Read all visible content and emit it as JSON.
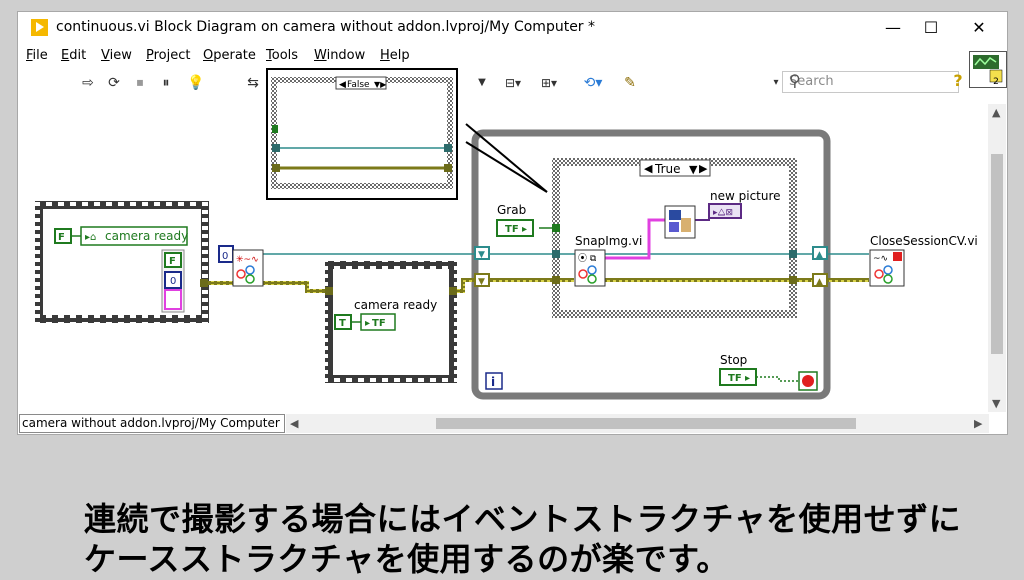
{
  "window": {
    "title": "continuous.vi Block Diagram on camera without addon.lvproj/My Computer *",
    "minimize": "—",
    "maximize": "☐",
    "close": "✕"
  },
  "menu": {
    "items": [
      {
        "label": "File",
        "key": "F"
      },
      {
        "label": "Edit",
        "key": "E"
      },
      {
        "label": "View",
        "key": "V"
      },
      {
        "label": "Project",
        "key": "P"
      },
      {
        "label": "Operate",
        "key": "O"
      },
      {
        "label": "Tools",
        "key": "T"
      },
      {
        "label": "Window",
        "key": "W"
      },
      {
        "label": "Help",
        "key": "H"
      }
    ]
  },
  "toolbar": {
    "run": "⇨",
    "run_continuous": "⟳",
    "abort": "⏹",
    "pause": "⏸",
    "highlight": "💡",
    "retain": "⇆",
    "search_placeholder": "Search",
    "help_glyph": "?"
  },
  "connector": {
    "label": "2"
  },
  "diagram": {
    "case_false_label": "False",
    "case_true_label": "True",
    "frame1_bool_label": "F",
    "frame1_camera_ready": "camera ready",
    "frame1_stack_f": "F",
    "frame1_numeric": "0",
    "init_numeric": "0",
    "frame2_camera_ready": "camera ready",
    "frame2_bool_label": "T",
    "frame2_tf": "TF",
    "grab_label": "Grab",
    "grab_tf": "TF",
    "grab_q": "?",
    "snap_label": "SnapImg.vi",
    "new_picture_label": "new picture",
    "close_label": "CloseSessionCV.vi",
    "stop_label": "Stop",
    "stop_tf": "TF",
    "loop_index": "i"
  },
  "status": {
    "project_path": "camera without addon.lvproj/My Computer"
  },
  "caption": {
    "line1": "連続で撮影する場合にはイベントストラクチャを使用せずに",
    "line2": "ケースストラクチャを使用するのが楽です。"
  }
}
